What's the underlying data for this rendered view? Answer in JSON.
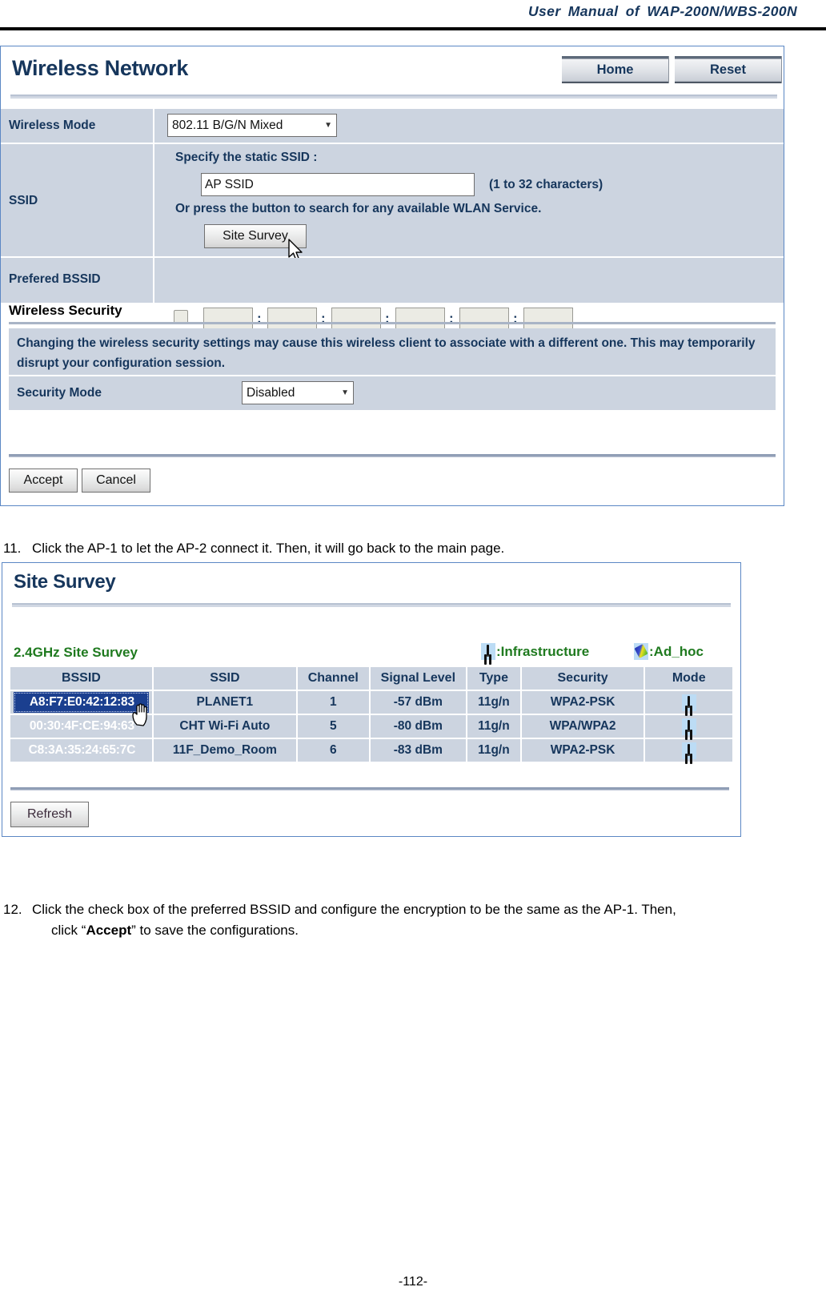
{
  "document": {
    "header_title": "User Manual of WAP-200N/WBS-200N",
    "page_number": "-112-"
  },
  "wireless_panel": {
    "title": "Wireless Network",
    "buttons": {
      "home": "Home",
      "reset": "Reset"
    },
    "wireless_mode": {
      "label": "Wireless Mode",
      "value": "802.11 B/G/N Mixed"
    },
    "ssid": {
      "label": "SSID",
      "specify_label": "Specify the static SSID  :",
      "value": "AP SSID",
      "hint": "(1 to 32 characters)",
      "or_press_text": "Or press the button to search for any available WLAN Service.",
      "site_survey_button": "Site Survey"
    },
    "prefered_bssid": {
      "label": "Prefered BSSID",
      "checkbox_checked": false,
      "octets": [
        "",
        "",
        "",
        "",
        "",
        ""
      ],
      "separator": ":"
    },
    "wireless_security": {
      "section_title": "Wireless Security",
      "notice": "Changing the wireless security settings may cause this wireless client to associate with a different one. This may temporarily disrupt your configuration session.",
      "security_mode_label": "Security Mode",
      "security_mode_value": "Disabled"
    },
    "footer_buttons": {
      "accept": "Accept",
      "cancel": "Cancel"
    }
  },
  "instructions": {
    "step11": {
      "number": "11.",
      "text": "Click the AP-1 to let the AP-2 connect it. Then, it will go back to the main page."
    },
    "step12": {
      "number": "12.",
      "line1": "Click the check box of the preferred BSSID and configure the encryption to be the same as the AP-1. Then,",
      "line2_pre": "click “",
      "line2_bold": "Accept",
      "line2_post": "” to save the configurations."
    }
  },
  "site_survey_panel": {
    "title": "Site Survey",
    "band_title": "2.4GHz Site Survey",
    "legend": {
      "infrastructure_icon": "infrastructure-icon",
      "infrastructure_label": ":Infrastructure",
      "adhoc_icon": "adhoc-icon",
      "adhoc_label": ":Ad_hoc"
    },
    "table": {
      "columns": [
        "BSSID",
        "SSID",
        "Channel",
        "Signal Level",
        "Type",
        "Security",
        "Mode"
      ],
      "rows": [
        {
          "bssid": "A8:F7:E0:42:12:83",
          "ssid": "PLANET1",
          "channel": "1",
          "signal_level": "-57 dBm",
          "type": "11g/n",
          "security": "WPA2-PSK",
          "mode": "infrastructure-icon",
          "selected": true
        },
        {
          "bssid": "00:30:4F:CE:94:63",
          "ssid": "CHT Wi-Fi Auto",
          "channel": "5",
          "signal_level": "-80 dBm",
          "type": "11g/n",
          "security": "WPA/WPA2",
          "mode": "infrastructure-icon",
          "selected": false
        },
        {
          "bssid": "C8:3A:35:24:65:7C",
          "ssid": "11F_Demo_Room",
          "channel": "6",
          "signal_level": "-83 dBm",
          "type": "11g/n",
          "security": "WPA2-PSK",
          "mode": "infrastructure-icon",
          "selected": false
        }
      ]
    },
    "refresh_button": "Refresh"
  },
  "colors": {
    "header_blue": "#16365c",
    "row_bg": "#ccd4e0",
    "panel_border": "#5b87c4",
    "legend_green": "#1f7a1f",
    "selected_bssid_bg": "#1b3f8f"
  }
}
